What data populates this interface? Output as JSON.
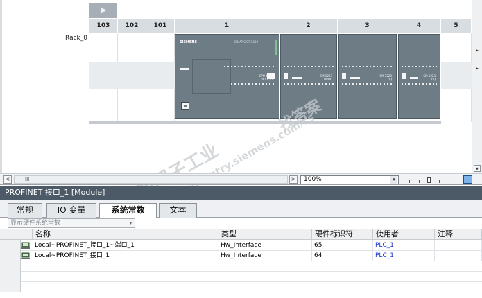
{
  "device_view": {
    "slots": [
      "103",
      "102",
      "101",
      "1",
      "2",
      "3",
      "4",
      "5"
    ],
    "rack_label": "Rack_0",
    "modules": [
      {
        "brand": "SIEMENS",
        "model": "SIMATIC S7-1200",
        "label": "CPU 1214C\nDC/DC/DC"
      },
      {
        "label": "SM 1223\nDI/DQ"
      },
      {
        "label": "SM 1223\nDQ"
      },
      {
        "label": "SM 1223\nDQ"
      }
    ],
    "watermark": {
      "line1": "西门子工业",
      "line2": "support.industry.siemens.com/cs",
      "line3": "找答案"
    }
  },
  "scrollbar": {
    "left_arrow": "<",
    "grip": "III",
    "right_arrow": ">",
    "zoom": "100%",
    "zoom_dropdown": "▾",
    "up_arrow": "▸",
    "down_arrow": "▾"
  },
  "panel": {
    "title": "PROFINET 接口_1 [Module]",
    "tabs": [
      {
        "label": "常规",
        "active": false
      },
      {
        "label": "IO 变量",
        "active": false
      },
      {
        "label": "系统常数",
        "active": true
      },
      {
        "label": "文本",
        "active": false
      }
    ],
    "filter": {
      "value": "显示硬件系统常数",
      "dropdown": "▾"
    },
    "table": {
      "headers": [
        "名称",
        "类型",
        "硬件标识符",
        "使用者",
        "注释"
      ],
      "rows": [
        {
          "name": "Local~PROFINET_接口_1~端口_1",
          "type": "Hw_Interface",
          "hw_id": "65",
          "user": "PLC_1",
          "comment": ""
        },
        {
          "name": "Local~PROFINET_接口_1",
          "type": "Hw_Interface",
          "hw_id": "64",
          "user": "PLC_1",
          "comment": ""
        }
      ]
    }
  },
  "colors": {
    "module": "#6e7c86",
    "panel_title": "#4b5a66",
    "link": "#1a35c8",
    "status_green": "#7fbf90"
  }
}
